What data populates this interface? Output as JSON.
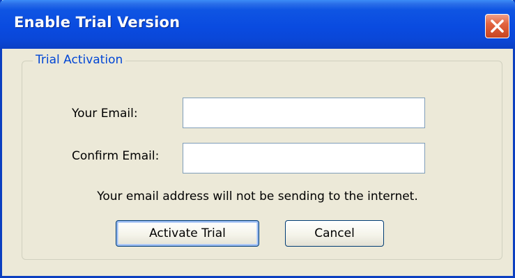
{
  "window": {
    "title": "Enable Trial Version",
    "close_icon": "close-x-icon"
  },
  "group": {
    "legend": "Trial Activation"
  },
  "form": {
    "email_label": "Your Email:",
    "email_value": "",
    "confirm_label": "Confirm Email:",
    "confirm_value": "",
    "info_text": "Your email address will not be sending to the internet."
  },
  "buttons": {
    "activate_label": "Activate Trial",
    "cancel_label": "Cancel"
  },
  "colors": {
    "titlebar": "#0a4be0",
    "legend_text": "#0046d5",
    "close_button": "#e2643f",
    "dialog_background": "#ece9d8"
  }
}
